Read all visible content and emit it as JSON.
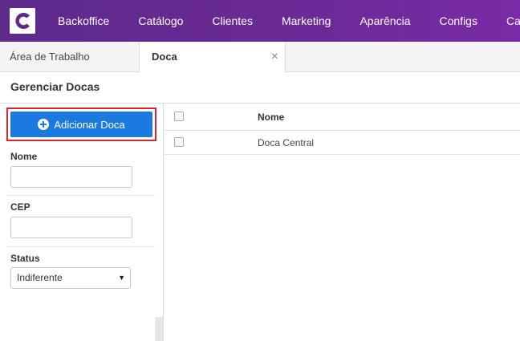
{
  "nav": {
    "logo_icon": "brand-c-logo",
    "items": [
      "Backoffice",
      "Catálogo",
      "Clientes",
      "Marketing",
      "Aparência",
      "Configs",
      "Canais"
    ]
  },
  "tabs": {
    "home_label": "Área de Trabalho",
    "active_label": "Doca",
    "close_glyph": "×"
  },
  "page": {
    "title": "Gerenciar Docas"
  },
  "actions": {
    "add_label": "Adicionar Doca",
    "add_icon": "plus-circle-icon"
  },
  "filters": {
    "name_label": "Nome",
    "name_value": "",
    "cep_label": "CEP",
    "cep_value": "",
    "status_label": "Status",
    "status_selected": "Indiferente"
  },
  "table": {
    "columns": [
      "Nome"
    ],
    "rows": [
      {
        "nome": "Doca Central"
      }
    ]
  },
  "colors": {
    "nav_bg": "#6b2a97",
    "primary_button": "#1b7ae0",
    "highlight_border": "#d9252c"
  }
}
